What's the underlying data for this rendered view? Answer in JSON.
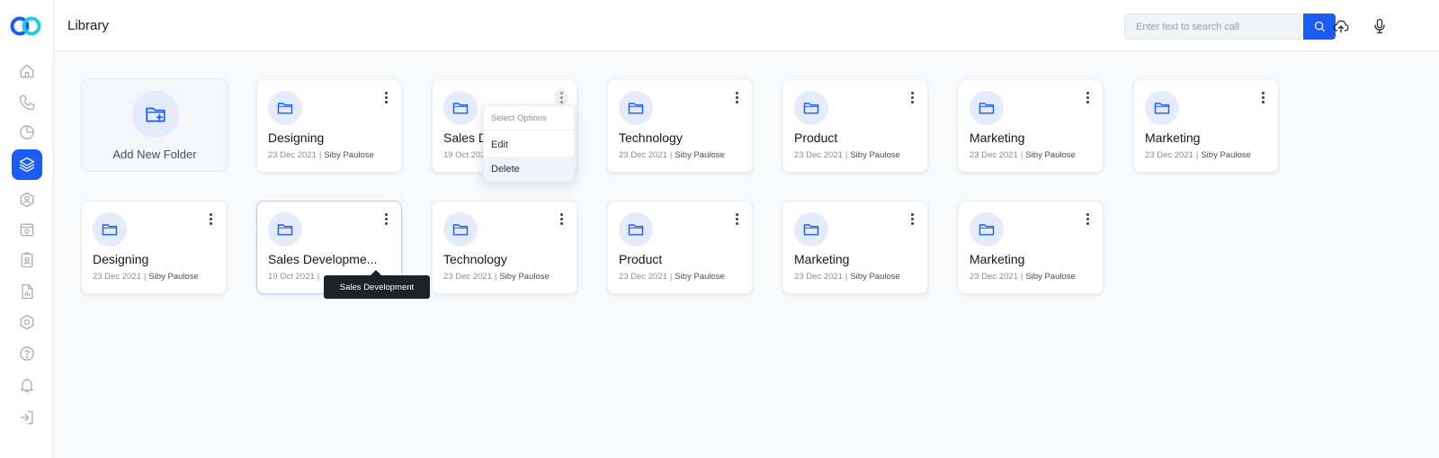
{
  "header": {
    "title": "Library",
    "search_placeholder": "Enter text to search call",
    "search_icon": "search-icon",
    "upload_icon": "cloud-upload-icon",
    "mic_icon": "microphone-icon"
  },
  "sidebar": {
    "items": [
      {
        "icon": "home-icon"
      },
      {
        "icon": "phone-icon"
      },
      {
        "icon": "pie-chart-icon"
      },
      {
        "icon": "layers-icon",
        "active": true
      },
      {
        "icon": "user-settings-icon"
      },
      {
        "icon": "calendar-icon"
      },
      {
        "icon": "id-badge-icon"
      },
      {
        "icon": "report-icon"
      },
      {
        "icon": "settings-hex-icon"
      },
      {
        "icon": "help-icon"
      },
      {
        "icon": "bell-icon"
      },
      {
        "icon": "logout-icon"
      }
    ]
  },
  "add_folder": {
    "label": "Add New Folder"
  },
  "folders": [
    {
      "name": "Designing",
      "date": "23 Dec 2021",
      "author": "Siby Paulose"
    },
    {
      "name": "Sales Development",
      "display_name": "Sales D",
      "date": "19 Oct 202",
      "author": ""
    },
    {
      "name": "Technology",
      "date": "23 Dec 2021",
      "author": "Siby Paulose"
    },
    {
      "name": "Product",
      "date": "23 Dec 2021",
      "author": "Siby Paulose"
    },
    {
      "name": "Marketing",
      "date": "23 Dec 2021",
      "author": "Siby Paulose"
    },
    {
      "name": "Marketing",
      "date": "23 Dec 2021",
      "author": "Siby Paulose"
    },
    {
      "name": "Designing",
      "date": "23 Dec 2021",
      "author": "Siby Paulose"
    },
    {
      "name": "Sales Developme...",
      "date": "19 Oct 2021",
      "author": ""
    },
    {
      "name": "Technology",
      "date": "23 Dec 2021",
      "author": "Siby Paulose"
    },
    {
      "name": "Product",
      "date": "23 Dec 2021",
      "author": "Siby Paulose"
    },
    {
      "name": "Marketing",
      "date": "23 Dec 2021",
      "author": "Siby Paulose"
    },
    {
      "name": "Marketing",
      "date": "23 Dec 2021",
      "author": "Siby Paulose"
    }
  ],
  "menu": {
    "header": "Select Options",
    "items": [
      "Edit",
      "Delete"
    ],
    "highlighted": "Delete"
  },
  "tooltip": {
    "text": "Sales Development"
  },
  "colors": {
    "accent": "#1a5cf5",
    "folder_bg": "#e3ebfc"
  }
}
